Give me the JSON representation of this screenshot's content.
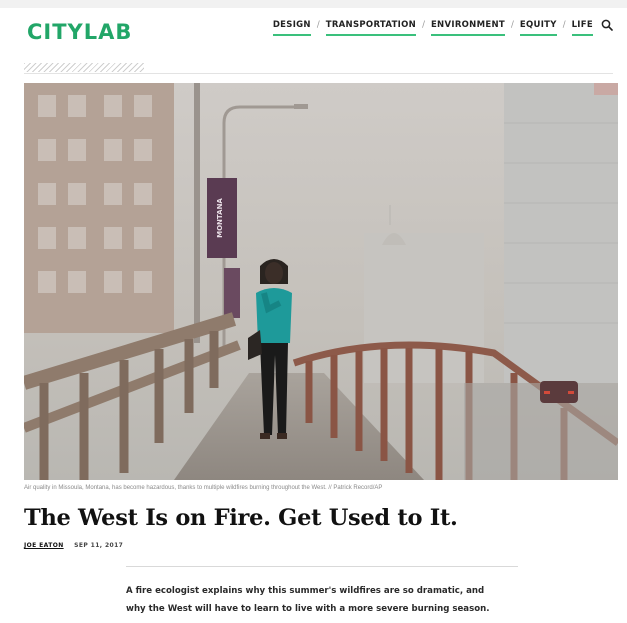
{
  "site": {
    "logo": "CITYLAB"
  },
  "nav": {
    "items": [
      {
        "label": "DESIGN"
      },
      {
        "label": "TRANSPORTATION"
      },
      {
        "label": "ENVIRONMENT"
      },
      {
        "label": "EQUITY"
      },
      {
        "label": "LIFE"
      }
    ],
    "separator": "/",
    "search_icon": "search-icon"
  },
  "hero": {
    "banner_text": "MONTANA",
    "caption": "Air quality in Missoula, Montana, has become hazardous, thanks to multiple wildfires burning throughout the West. // Patrick Record/AP"
  },
  "article": {
    "headline": "The West Is on Fire. Get Used to It.",
    "author": "JOE EATON",
    "date": "SEP 11, 2017",
    "dek_line1": "A fire ecologist explains why this summer's wildfires are so dramatic, and",
    "dek_line2": "why the West will have to learn to live with a more severe burning season."
  },
  "colors": {
    "brand": "#22a668",
    "nav_underline": "#3ac07c"
  }
}
